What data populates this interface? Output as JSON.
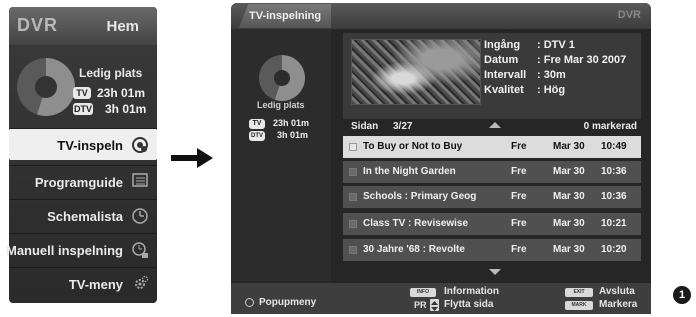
{
  "menu": {
    "logo": "DVR",
    "title": "Hem",
    "free_space_label": "Ledig plats",
    "tv_badge": "TV",
    "tv_time": "23h 01m",
    "dtv_badge": "DTV",
    "dtv_time": "3h 01m",
    "items": [
      {
        "label": "TV-inspeln",
        "icon": "record-icon"
      },
      {
        "label": "Programguide",
        "icon": "guide-icon"
      },
      {
        "label": "Schemalista",
        "icon": "clock-icon"
      },
      {
        "label": "Manuell inspelning",
        "icon": "manual-clock-icon"
      },
      {
        "label": "TV-meny",
        "icon": "gear-icon"
      }
    ]
  },
  "panel": {
    "title": "TV-inspelning",
    "logo": "DVR",
    "free_space_label": "Ledig plats",
    "tv_badge": "TV",
    "tv_time": "23h 01m",
    "dtv_badge": "DTV",
    "dtv_time": "3h 01m",
    "info": {
      "source_k": "Ingång",
      "source_v": ": DTV 1",
      "date_k": "Datum",
      "date_v": ": Fre Mar 30 2007",
      "interval_k": "Intervall",
      "interval_v": ": 30m",
      "quality_k": "Kvalitet",
      "quality_v": ": Hög"
    },
    "page_label": "Sidan",
    "page_value": "3/27",
    "marked": "0 markerad",
    "recordings": [
      {
        "title": "To Buy or Not to Buy",
        "day": "Fre",
        "date": "Mar 30",
        "time": "10:49"
      },
      {
        "title": "In the Night Garden",
        "day": "Fre",
        "date": "Mar 30",
        "time": "10:36"
      },
      {
        "title": "Schools : Primary Geog",
        "day": "Fre",
        "date": "Mar 30",
        "time": "10:36"
      },
      {
        "title": "Class TV : Revisewise",
        "day": "Fre",
        "date": "Mar 30",
        "time": "10:21"
      },
      {
        "title": "30 Jahre '68 : Revolte",
        "day": "Fre",
        "date": "Mar 30",
        "time": "10:20"
      }
    ]
  },
  "bottom": {
    "popup": "Popupmeny",
    "info_key": "INFO",
    "info_label": "Information",
    "pr_key": "PR",
    "pr_label": "Flytta sida",
    "exit_key": "EXIT",
    "exit_label": "Avsluta",
    "mark_key": "MARK",
    "mark_label": "Markera"
  },
  "callout": "1"
}
